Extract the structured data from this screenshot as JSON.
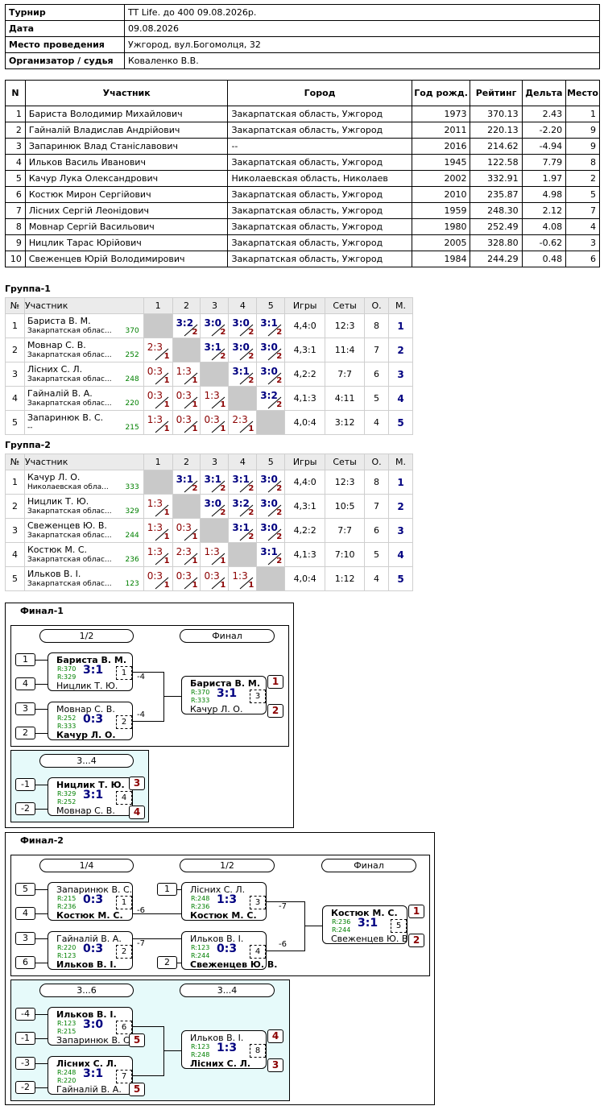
{
  "info": {
    "tournament_label": "Турнир",
    "tournament": "TT Life. до 400 09.08.2026р.",
    "date_label": "Дата",
    "date": "09.08.2026",
    "venue_label": "Место проведения",
    "venue": "Ужгород, вул.Богомолця, 32",
    "organizer_label": "Организатор / судья",
    "organizer": "Коваленко В.В."
  },
  "participants": {
    "headers": [
      "N",
      "Участник",
      "Город",
      "Год рожд.",
      "Рейтинг",
      "Дельта",
      "Место"
    ],
    "rows": [
      [
        "1",
        "Бариста Володимир Михайлович",
        "Закарпатская область, Ужгород",
        "1973",
        "370.13",
        "2.43",
        "1"
      ],
      [
        "2",
        "Гайналій Владислав Андрійович",
        "Закарпатская область, Ужгород",
        "2011",
        "220.13",
        "-2.20",
        "9"
      ],
      [
        "3",
        "Запаринюк Влад Станіславович",
        "--",
        "2016",
        "214.62",
        "-4.94",
        "9"
      ],
      [
        "4",
        "Ильков Василь Иванович",
        "Закарпатская область, Ужгород",
        "1945",
        "122.58",
        "7.79",
        "8"
      ],
      [
        "5",
        "Качур Лука Олександрович",
        "Николаевская область, Николаев",
        "2002",
        "332.91",
        "1.97",
        "2"
      ],
      [
        "6",
        "Костюк Мирон Сергійович",
        "Закарпатская область, Ужгород",
        "2010",
        "235.87",
        "4.98",
        "5"
      ],
      [
        "7",
        "Лісних Сергій Леонідович",
        "Закарпатская область, Ужгород",
        "1959",
        "248.30",
        "2.12",
        "7"
      ],
      [
        "8",
        "Мовнар Сергій Васильович",
        "Закарпатская область, Ужгород",
        "1980",
        "252.49",
        "4.08",
        "4"
      ],
      [
        "9",
        "Ницлик Тарас Юрійович",
        "Закарпатская область, Ужгород",
        "2005",
        "328.80",
        "-0.62",
        "3"
      ],
      [
        "10",
        "Свеженцев Юрій Володимирович",
        "Закарпатская область, Ужгород",
        "1984",
        "244.29",
        "0.48",
        "6"
      ]
    ]
  },
  "groups": [
    {
      "title": "Группа-1",
      "headers": [
        "№",
        "Участник",
        "1",
        "2",
        "3",
        "4",
        "5",
        "Игры",
        "Сеты",
        "О.",
        "М."
      ],
      "rows": [
        {
          "n": "1",
          "name": "Бариста В. М.",
          "city": "Закарпатская облас...",
          "rating": "370",
          "cells": [
            null,
            [
              "3:2",
              "2"
            ],
            [
              "3:0",
              "2"
            ],
            [
              "3:0",
              "2"
            ],
            [
              "3:1",
              "2"
            ]
          ],
          "games": "4,4:0",
          "sets": "12:3",
          "pts": "8",
          "place": "1"
        },
        {
          "n": "2",
          "name": "Мовнар С. В.",
          "city": "Закарпатская облас...",
          "rating": "252",
          "cells": [
            [
              "2:3",
              "1"
            ],
            null,
            [
              "3:1",
              "2"
            ],
            [
              "3:0",
              "2"
            ],
            [
              "3:0",
              "2"
            ]
          ],
          "games": "4,3:1",
          "sets": "11:4",
          "pts": "7",
          "place": "2"
        },
        {
          "n": "3",
          "name": "Лісних С. Л.",
          "city": "Закарпатская облас...",
          "rating": "248",
          "cells": [
            [
              "0:3",
              "1"
            ],
            [
              "1:3",
              "1"
            ],
            null,
            [
              "3:1",
              "2"
            ],
            [
              "3:0",
              "2"
            ]
          ],
          "games": "4,2:2",
          "sets": "7:7",
          "pts": "6",
          "place": "3"
        },
        {
          "n": "4",
          "name": "Гайналій В. А.",
          "city": "Закарпатская облас...",
          "rating": "220",
          "cells": [
            [
              "0:3",
              "1"
            ],
            [
              "0:3",
              "1"
            ],
            [
              "1:3",
              "1"
            ],
            null,
            [
              "3:2",
              "2"
            ]
          ],
          "games": "4,1:3",
          "sets": "4:11",
          "pts": "5",
          "place": "4"
        },
        {
          "n": "5",
          "name": "Запаринюк В. С.",
          "city": "--",
          "rating": "215",
          "cells": [
            [
              "1:3",
              "1"
            ],
            [
              "0:3",
              "1"
            ],
            [
              "0:3",
              "1"
            ],
            [
              "2:3",
              "1"
            ],
            null
          ],
          "games": "4,0:4",
          "sets": "3:12",
          "pts": "4",
          "place": "5"
        }
      ]
    },
    {
      "title": "Группа-2",
      "headers": [
        "№",
        "Участник",
        "1",
        "2",
        "3",
        "4",
        "5",
        "Игры",
        "Сеты",
        "О.",
        "М."
      ],
      "rows": [
        {
          "n": "1",
          "name": "Качур Л. О.",
          "city": "Николаевская обла...",
          "rating": "333",
          "cells": [
            null,
            [
              "3:1",
              "2"
            ],
            [
              "3:1",
              "2"
            ],
            [
              "3:1",
              "2"
            ],
            [
              "3:0",
              "2"
            ]
          ],
          "games": "4,4:0",
          "sets": "12:3",
          "pts": "8",
          "place": "1"
        },
        {
          "n": "2",
          "name": "Ницлик Т. Ю.",
          "city": "Закарпатская облас...",
          "rating": "329",
          "cells": [
            [
              "1:3",
              "1"
            ],
            null,
            [
              "3:0",
              "2"
            ],
            [
              "3:2",
              "2"
            ],
            [
              "3:0",
              "2"
            ]
          ],
          "games": "4,3:1",
          "sets": "10:5",
          "pts": "7",
          "place": "2"
        },
        {
          "n": "3",
          "name": "Свеженцев Ю. В.",
          "city": "Закарпатская облас...",
          "rating": "244",
          "cells": [
            [
              "1:3",
              "1"
            ],
            [
              "0:3",
              "1"
            ],
            null,
            [
              "3:1",
              "2"
            ],
            [
              "3:0",
              "2"
            ]
          ],
          "games": "4,2:2",
          "sets": "7:7",
          "pts": "6",
          "place": "3"
        },
        {
          "n": "4",
          "name": "Костюк М. С.",
          "city": "Закарпатская облас...",
          "rating": "236",
          "cells": [
            [
              "1:3",
              "1"
            ],
            [
              "2:3",
              "1"
            ],
            [
              "1:3",
              "1"
            ],
            null,
            [
              "3:1",
              "2"
            ]
          ],
          "games": "4,1:3",
          "sets": "7:10",
          "pts": "5",
          "place": "4"
        },
        {
          "n": "5",
          "name": "Ильков В. І.",
          "city": "Закарпатская облас...",
          "rating": "123",
          "cells": [
            [
              "0:3",
              "1"
            ],
            [
              "0:3",
              "1"
            ],
            [
              "0:3",
              "1"
            ],
            [
              "1:3",
              "1"
            ],
            null
          ],
          "games": "4,0:4",
          "sets": "1:12",
          "pts": "4",
          "place": "5"
        }
      ]
    }
  ],
  "final1": {
    "title": "Финал-1",
    "rounds": {
      "semi": "1/2",
      "final": "Финал",
      "third": "3...4"
    },
    "seeds": [
      "1",
      "4",
      "3",
      "2",
      "-1",
      "-2"
    ],
    "m1": {
      "p1": "Бариста В. М.",
      "r1": "R:370",
      "r2": "R:329",
      "p2": "Ницлик Т. Ю.",
      "score": "3:1",
      "num": "1",
      "loser": "-4"
    },
    "m2": {
      "p1": "Мовнар С. В.",
      "r1": "R:252",
      "r2": "R:333",
      "p2": "Качур Л. О.",
      "score": "0:3",
      "num": "2",
      "loser": "-4"
    },
    "m3": {
      "p1": "Бариста В. М.",
      "r1": "R:370",
      "r2": "R:333",
      "p2": "Качур Л. О.",
      "score": "3:1",
      "num": "3",
      "res1": "1",
      "res2": "2"
    },
    "m4": {
      "p1": "Ницлик Т. Ю.",
      "r1": "R:329",
      "r2": "R:252",
      "p2": "Мовнар С. В.",
      "score": "3:1",
      "num": "4",
      "res1": "3",
      "res2": "4"
    }
  },
  "final2": {
    "title": "Финал-2",
    "rounds": {
      "quarter": "1/4",
      "semi": "1/2",
      "final": "Финал",
      "r36": "3...6",
      "r34": "3...4"
    },
    "seeds": [
      "5",
      "4",
      "3",
      "6",
      "1",
      "2",
      "-4",
      "-1",
      "-3",
      "-2"
    ],
    "m1": {
      "p1": "Запаринюк В. С.",
      "r1": "R:215",
      "r2": "R:236",
      "p2": "Костюк М. С.",
      "score": "0:3",
      "num": "1",
      "loser": "-6"
    },
    "m2": {
      "p1": "Гайналій В. А.",
      "r1": "R:220",
      "r2": "R:123",
      "p2": "Ильков В. І.",
      "score": "0:3",
      "num": "2",
      "loser": "-7"
    },
    "m3": {
      "p1": "Лісних С. Л.",
      "r1": "R:248",
      "r2": "R:236",
      "p2": "Костюк М. С.",
      "score": "1:3",
      "num": "3",
      "loser": "-7"
    },
    "m4": {
      "p1": "Ильков В. І.",
      "r1": "R:123",
      "r2": "R:244",
      "p2": "Свеженцев Ю. В.",
      "score": "0:3",
      "num": "4",
      "loser": "-6"
    },
    "m5": {
      "p1": "Костюк М. С.",
      "r1": "R:236",
      "r2": "R:244",
      "p2": "Свеженцев Ю. В.",
      "score": "3:1",
      "num": "5",
      "res1": "1",
      "res2": "2"
    },
    "m6": {
      "p1": "Ильков В. І.",
      "r1": "R:123",
      "r2": "R:215",
      "p2": "Запаринюк В. С.",
      "score": "3:0",
      "num": "6",
      "res2": "5"
    },
    "m7": {
      "p1": "Лісних С. Л.",
      "r1": "R:248",
      "r2": "R:220",
      "p2": "Гайналій В. А.",
      "score": "3:1",
      "num": "7",
      "res2": "5"
    },
    "m8": {
      "p1": "Ильков В. І.",
      "r1": "R:123",
      "r2": "R:248",
      "p2": "Лісних С. Л.",
      "score": "1:3",
      "num": "8",
      "res1": "4",
      "res2": "3"
    }
  }
}
